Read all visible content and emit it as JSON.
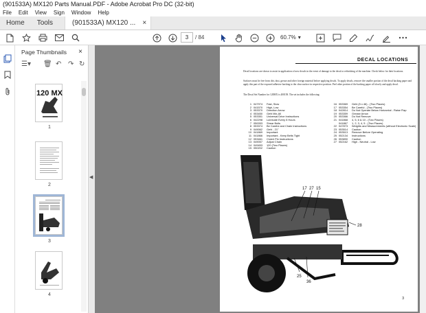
{
  "window": {
    "title": "(901533A) MX120 Parts Manual.PDF - Adobe Acrobat Pro DC (32-bit)"
  },
  "menu": [
    "File",
    "Edit",
    "View",
    "Sign",
    "Window",
    "Help"
  ],
  "tabs": {
    "home": "Home",
    "tools": "Tools",
    "document": "(901533A) MX120 ...",
    "close": "×"
  },
  "toolbar": {
    "current_page": "3",
    "total_pages": "/ 84",
    "zoom": "60.7%"
  },
  "thumbnails": {
    "header": "Page Thumbnails",
    "close": "×",
    "pages": [
      {
        "label": "1",
        "cover": "120 MX"
      },
      {
        "label": "2"
      },
      {
        "label": "3",
        "selected": true
      },
      {
        "label": "4"
      }
    ]
  },
  "page": {
    "title": "DECAL LOCATIONS",
    "para1": "Decal locations are shown to assist in application of new decals in the event of damage to the decal or refinishing of the machine. Check below for their locations.",
    "para2": "Surfaces must be free from dirt, dust, grease and other foreign material before applying decals. To apply decals, remove the smaller portion of the decal backing paper and apply this part of the exposed adhesive backing to the clear surface in respective position. Peel other portion of the backing paper off slowly and apply decal.",
    "para3": "The Decal Set Number for 120MX is 400158. The set includes the following:",
    "decals_left": [
      {
        "n": "1",
        "part": "047974",
        "desc": "Fast, Slow"
      },
      {
        "n": "2",
        "part": "041570",
        "desc": "High, Low"
      },
      {
        "n": "3",
        "part": "053370",
        "desc": "Direction Arrow"
      },
      {
        "n": "4",
        "part": "053450",
        "desc": "Gehl Mix-All"
      },
      {
        "n": "5",
        "part": "053351",
        "desc": "Universal Drive Instructions"
      },
      {
        "n": "6",
        "part": "042298",
        "desc": "Lubricate Every 5 Hours"
      },
      {
        "n": "7",
        "part": "050053",
        "desc": "Shear Bolts"
      },
      {
        "n": "8",
        "part": "053374",
        "desc": "Be Careful and Chain Instructions"
      },
      {
        "n": "9",
        "part": "049062",
        "desc": "Gehl - 21\""
      },
      {
        "n": "10",
        "part": "041869",
        "desc": "Important"
      },
      {
        "n": "11",
        "part": "041866",
        "desc": "Important - Keep Belts Tight"
      },
      {
        "n": "12",
        "part": "053461",
        "desc": "Clutch Pin Instructions"
      },
      {
        "n": "13",
        "part": "049057",
        "desc": "Adjust Chain"
      },
      {
        "n": "14",
        "part": "049453",
        "desc": "120 (Two Places)"
      },
      {
        "n": "15",
        "part": "050202",
        "desc": "Caution"
      }
    ],
    "decals_right": [
      {
        "n": "16",
        "part": "053369",
        "desc": "Gehl (5 x 46) - (Two Places)"
      },
      {
        "n": "17",
        "part": "053354",
        "desc": "Be Careful - (Two Places)"
      },
      {
        "n": "18",
        "part": "042814",
        "desc": "Do Not Operate Below Horizontal - Raise Flap"
      },
      {
        "n": "19",
        "part": "053359",
        "desc": "Grease Arrow"
      },
      {
        "n": "20",
        "part": "053366",
        "desc": "Do Not Remove"
      },
      {
        "n": "21",
        "part": "041868",
        "desc": "4, 5, 6 & 10 - (Two Places)"
      },
      {
        "n": "",
        "part": "041867",
        "desc": "1, 2, 3, 4, 5 - (Two Places)"
      },
      {
        "n": "22",
        "part": "047873",
        "desc": "Weights and Measurements (without Electronic Scale)"
      },
      {
        "n": "23",
        "part": "053514",
        "desc": "Caution"
      },
      {
        "n": "24",
        "part": "053513",
        "desc": "Remove Before Operating"
      },
      {
        "n": "25",
        "part": "052134",
        "desc": "Instructions"
      },
      {
        "n": "26",
        "part": "053890",
        "desc": "Caution"
      },
      {
        "n": "27",
        "part": "052162",
        "desc": "High - Neutral - Low"
      }
    ],
    "callouts": [
      "17",
      "27",
      "15",
      "28",
      "25",
      "36"
    ],
    "page_number": "3"
  }
}
